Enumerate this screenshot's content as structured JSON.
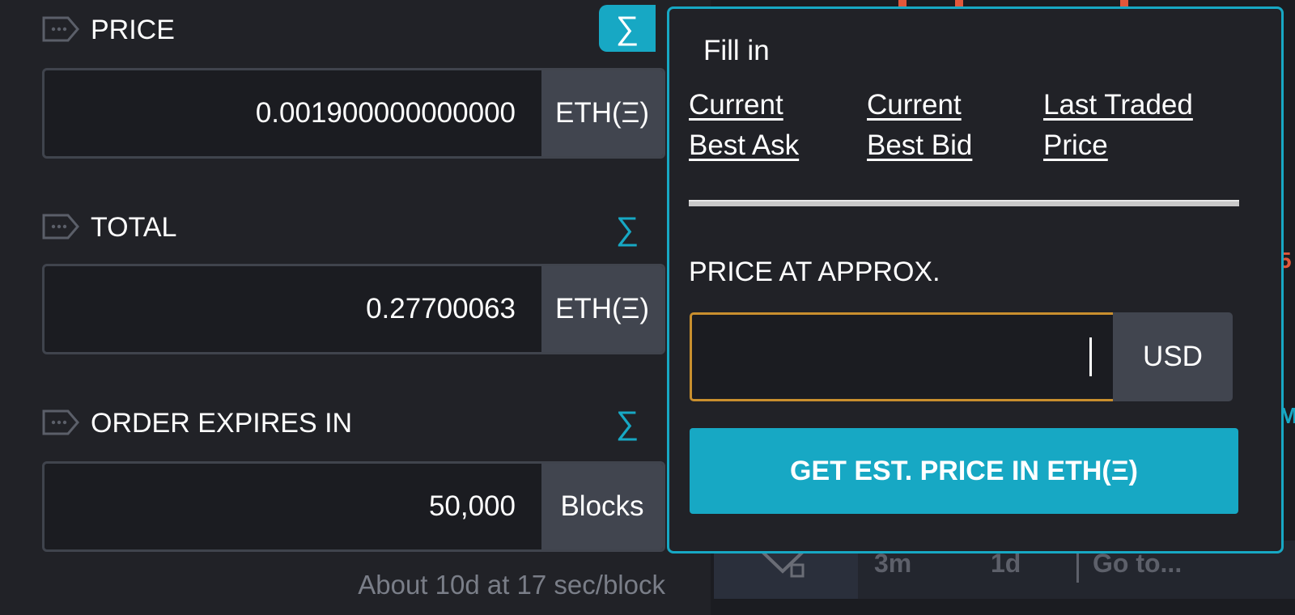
{
  "form": {
    "fields": [
      {
        "label": "PRICE",
        "value": "0.001900000000000",
        "unit": "ETH(Ξ)"
      },
      {
        "label": "TOTAL",
        "value": "0.27700063",
        "unit": "ETH(Ξ)"
      },
      {
        "label": "ORDER EXPIRES IN",
        "value": "50,000",
        "unit": "Blocks"
      }
    ],
    "sigma_symbol": "∑",
    "hint": "About 10d at 17 sec/block"
  },
  "popover": {
    "title": "Fill in",
    "links": [
      {
        "line1": "Current",
        "line2": "Best Ask"
      },
      {
        "line1": "Current",
        "line2": "Best Bid"
      },
      {
        "line1": "Last Traded",
        "line2": "Price"
      }
    ],
    "section_label": "PRICE AT APPROX.",
    "input_value": "",
    "input_unit": "USD",
    "button_label": "GET EST. PRICE IN ETH(Ξ)"
  },
  "chart_toolbar": {
    "buttons": [
      "3m",
      "1d",
      "Go to..."
    ]
  },
  "colors": {
    "accent": "#17a8c4",
    "focus_border": "#c98f2e",
    "background": "#212227",
    "unit_box": "#41454f",
    "chart_red": "#e2573a"
  }
}
